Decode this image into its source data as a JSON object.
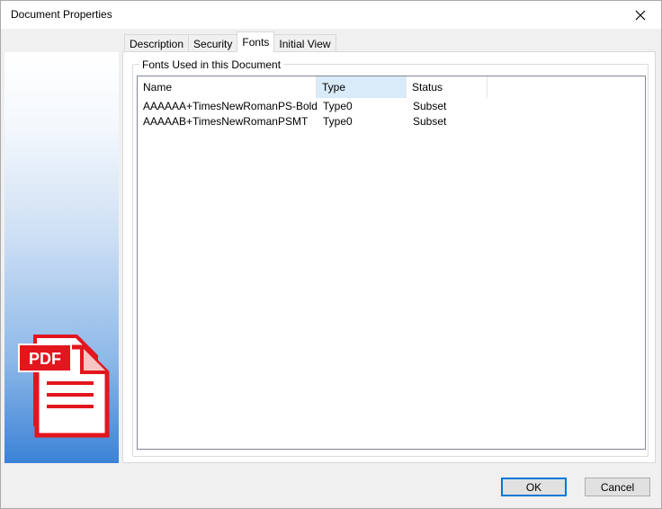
{
  "window": {
    "title": "Document Properties"
  },
  "tabs": [
    {
      "label": "Description",
      "active": false
    },
    {
      "label": "Security",
      "active": false
    },
    {
      "label": "Fonts",
      "active": true
    },
    {
      "label": "Initial View",
      "active": false
    }
  ],
  "fonts_group": {
    "label": "Fonts Used in this Document",
    "columns": [
      "Name",
      "Type",
      "Status"
    ],
    "rows": [
      {
        "name": "AAAAAA+TimesNewRomanPS-BoldMT",
        "type": "Type0",
        "status": "Subset"
      },
      {
        "name": "AAAAAB+TimesNewRomanPSMT",
        "type": "Type0",
        "status": "Subset"
      }
    ]
  },
  "logo": {
    "text": "PDF",
    "color": "#e3161e"
  },
  "buttons": {
    "ok": "OK",
    "cancel": "Cancel"
  },
  "colors": {
    "accent": "#0078d7",
    "header_hover": "#d9ebf9",
    "panel_gradient_bottom": "#3b82d6"
  },
  "icons": {
    "close": "close-icon",
    "logo": "pdf-document-icon"
  }
}
